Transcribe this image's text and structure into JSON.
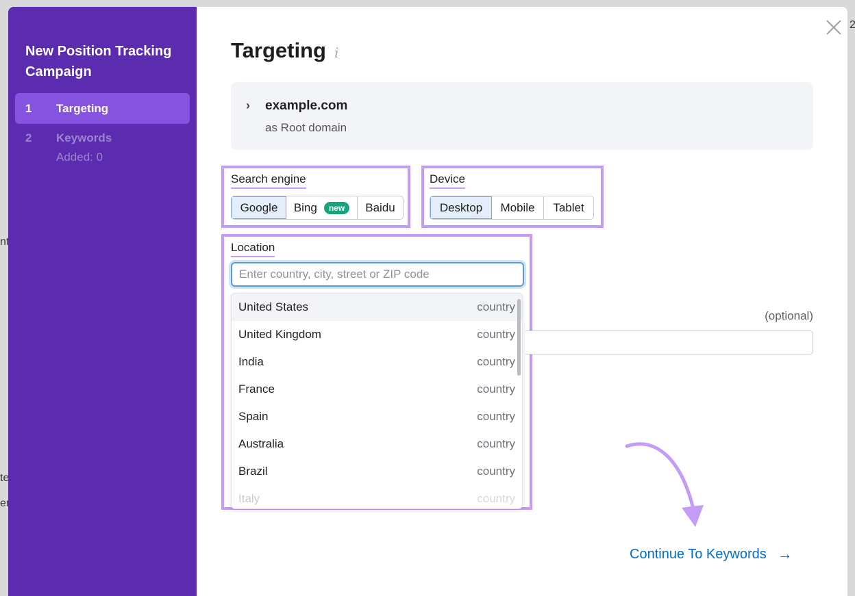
{
  "backdrop": {
    "frag1": "nt",
    "frag2": "te",
    "frag3": "er",
    "frag4": "2"
  },
  "sidebar": {
    "title": "New Position Tracking Campaign",
    "steps": [
      {
        "num": "1",
        "label": "Targeting",
        "sub": ""
      },
      {
        "num": "2",
        "label": "Keywords",
        "sub": "Added: 0"
      }
    ]
  },
  "main": {
    "title": "Targeting",
    "info_icon": "i",
    "domain": {
      "chevron": "›",
      "name": "example.com",
      "type": "as Root domain"
    },
    "search_engine": {
      "label": "Search engine",
      "options": [
        "Google",
        "Bing",
        "Baidu"
      ],
      "selected": "Google",
      "bing_badge": "new"
    },
    "device": {
      "label": "Device",
      "options": [
        "Desktop",
        "Mobile",
        "Tablet"
      ],
      "selected": "Desktop"
    },
    "location": {
      "label": "Location",
      "placeholder": "Enter country, city, street or ZIP code",
      "value": "",
      "suggestions": [
        {
          "name": "United States",
          "type": "country"
        },
        {
          "name": "United Kingdom",
          "type": "country"
        },
        {
          "name": "India",
          "type": "country"
        },
        {
          "name": "France",
          "type": "country"
        },
        {
          "name": "Spain",
          "type": "country"
        },
        {
          "name": "Australia",
          "type": "country"
        },
        {
          "name": "Brazil",
          "type": "country"
        },
        {
          "name": "Italy",
          "type": "country"
        }
      ]
    },
    "optional_label": "(optional)",
    "continue_label": "Continue To Keywords",
    "continue_arrow": "→"
  },
  "colors": {
    "sidebar": "#5b2bb0",
    "active_step": "#8652e0",
    "highlight": "#c39cf5",
    "link": "#006dca",
    "badge": "#19a37d"
  }
}
